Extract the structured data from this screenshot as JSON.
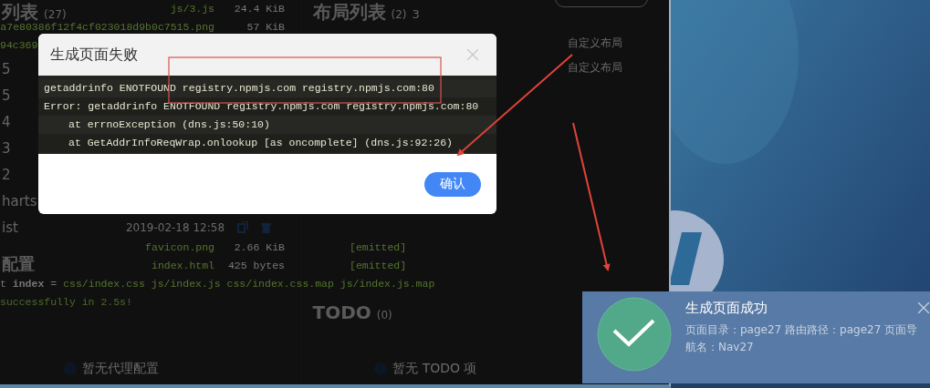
{
  "left_panel": {
    "heading": "列表",
    "count": "(27)",
    "items": [
      "5",
      "5",
      "4",
      "3",
      "2",
      "harts",
      "ist"
    ],
    "timestamp": "2019-02-18 12:58",
    "proxy_heading": "配置",
    "proxy_empty": "暂无代理配置"
  },
  "middle_panel": {
    "heading": "布局列表",
    "count": "(2)",
    "badge": "3",
    "todo_heading": "TODO",
    "todo_count": "(0)",
    "todo_empty": "暂无 TODO 项"
  },
  "right_panel": {
    "layouts": [
      "自定义布局",
      "自定义布局"
    ]
  },
  "terminal": {
    "top_assets": [
      {
        "name": "js/3.js",
        "size": "24.4 KiB"
      },
      {
        "name": "a7e80386f12f4cf023018d9b0c7515.png",
        "size": "57 KiB"
      }
    ],
    "cut_line": "94c369",
    "bottom_assets": [
      {
        "name": "favicon.png",
        "size": "2.66 KiB",
        "status": "[emitted]"
      },
      {
        "name": "index.html",
        "size": "425 bytes",
        "status": "[emitted]"
      }
    ],
    "entrypoint_label": "t **index** =",
    "entrypoint_files": "css/index.css js/index.js css/index.css.map js/index.js.map",
    "result": "successfully in 2.5s!"
  },
  "error_dialog": {
    "title": "生成页面失败",
    "lines": [
      {
        "text": "getaddrinfo ENOTFOUND registry.npmjs.com registry.npmjs.com:80",
        "indent": false
      },
      {
        "text": "Error: getaddrinfo ENOTFOUND registry.npmjs.com registry.npmjs.com:80",
        "indent": false
      },
      {
        "text": "at errnoException (dns.js:50:10)",
        "indent": true
      },
      {
        "text": "at GetAddrInfoReqWrap.onlookup [as oncomplete] (dns.js:92:26)",
        "indent": true
      }
    ],
    "confirm": "确认"
  },
  "toast": {
    "title": "生成页面成功",
    "message": "页面目录：page27 路由路径：page27 页面导航名：Nav27"
  }
}
